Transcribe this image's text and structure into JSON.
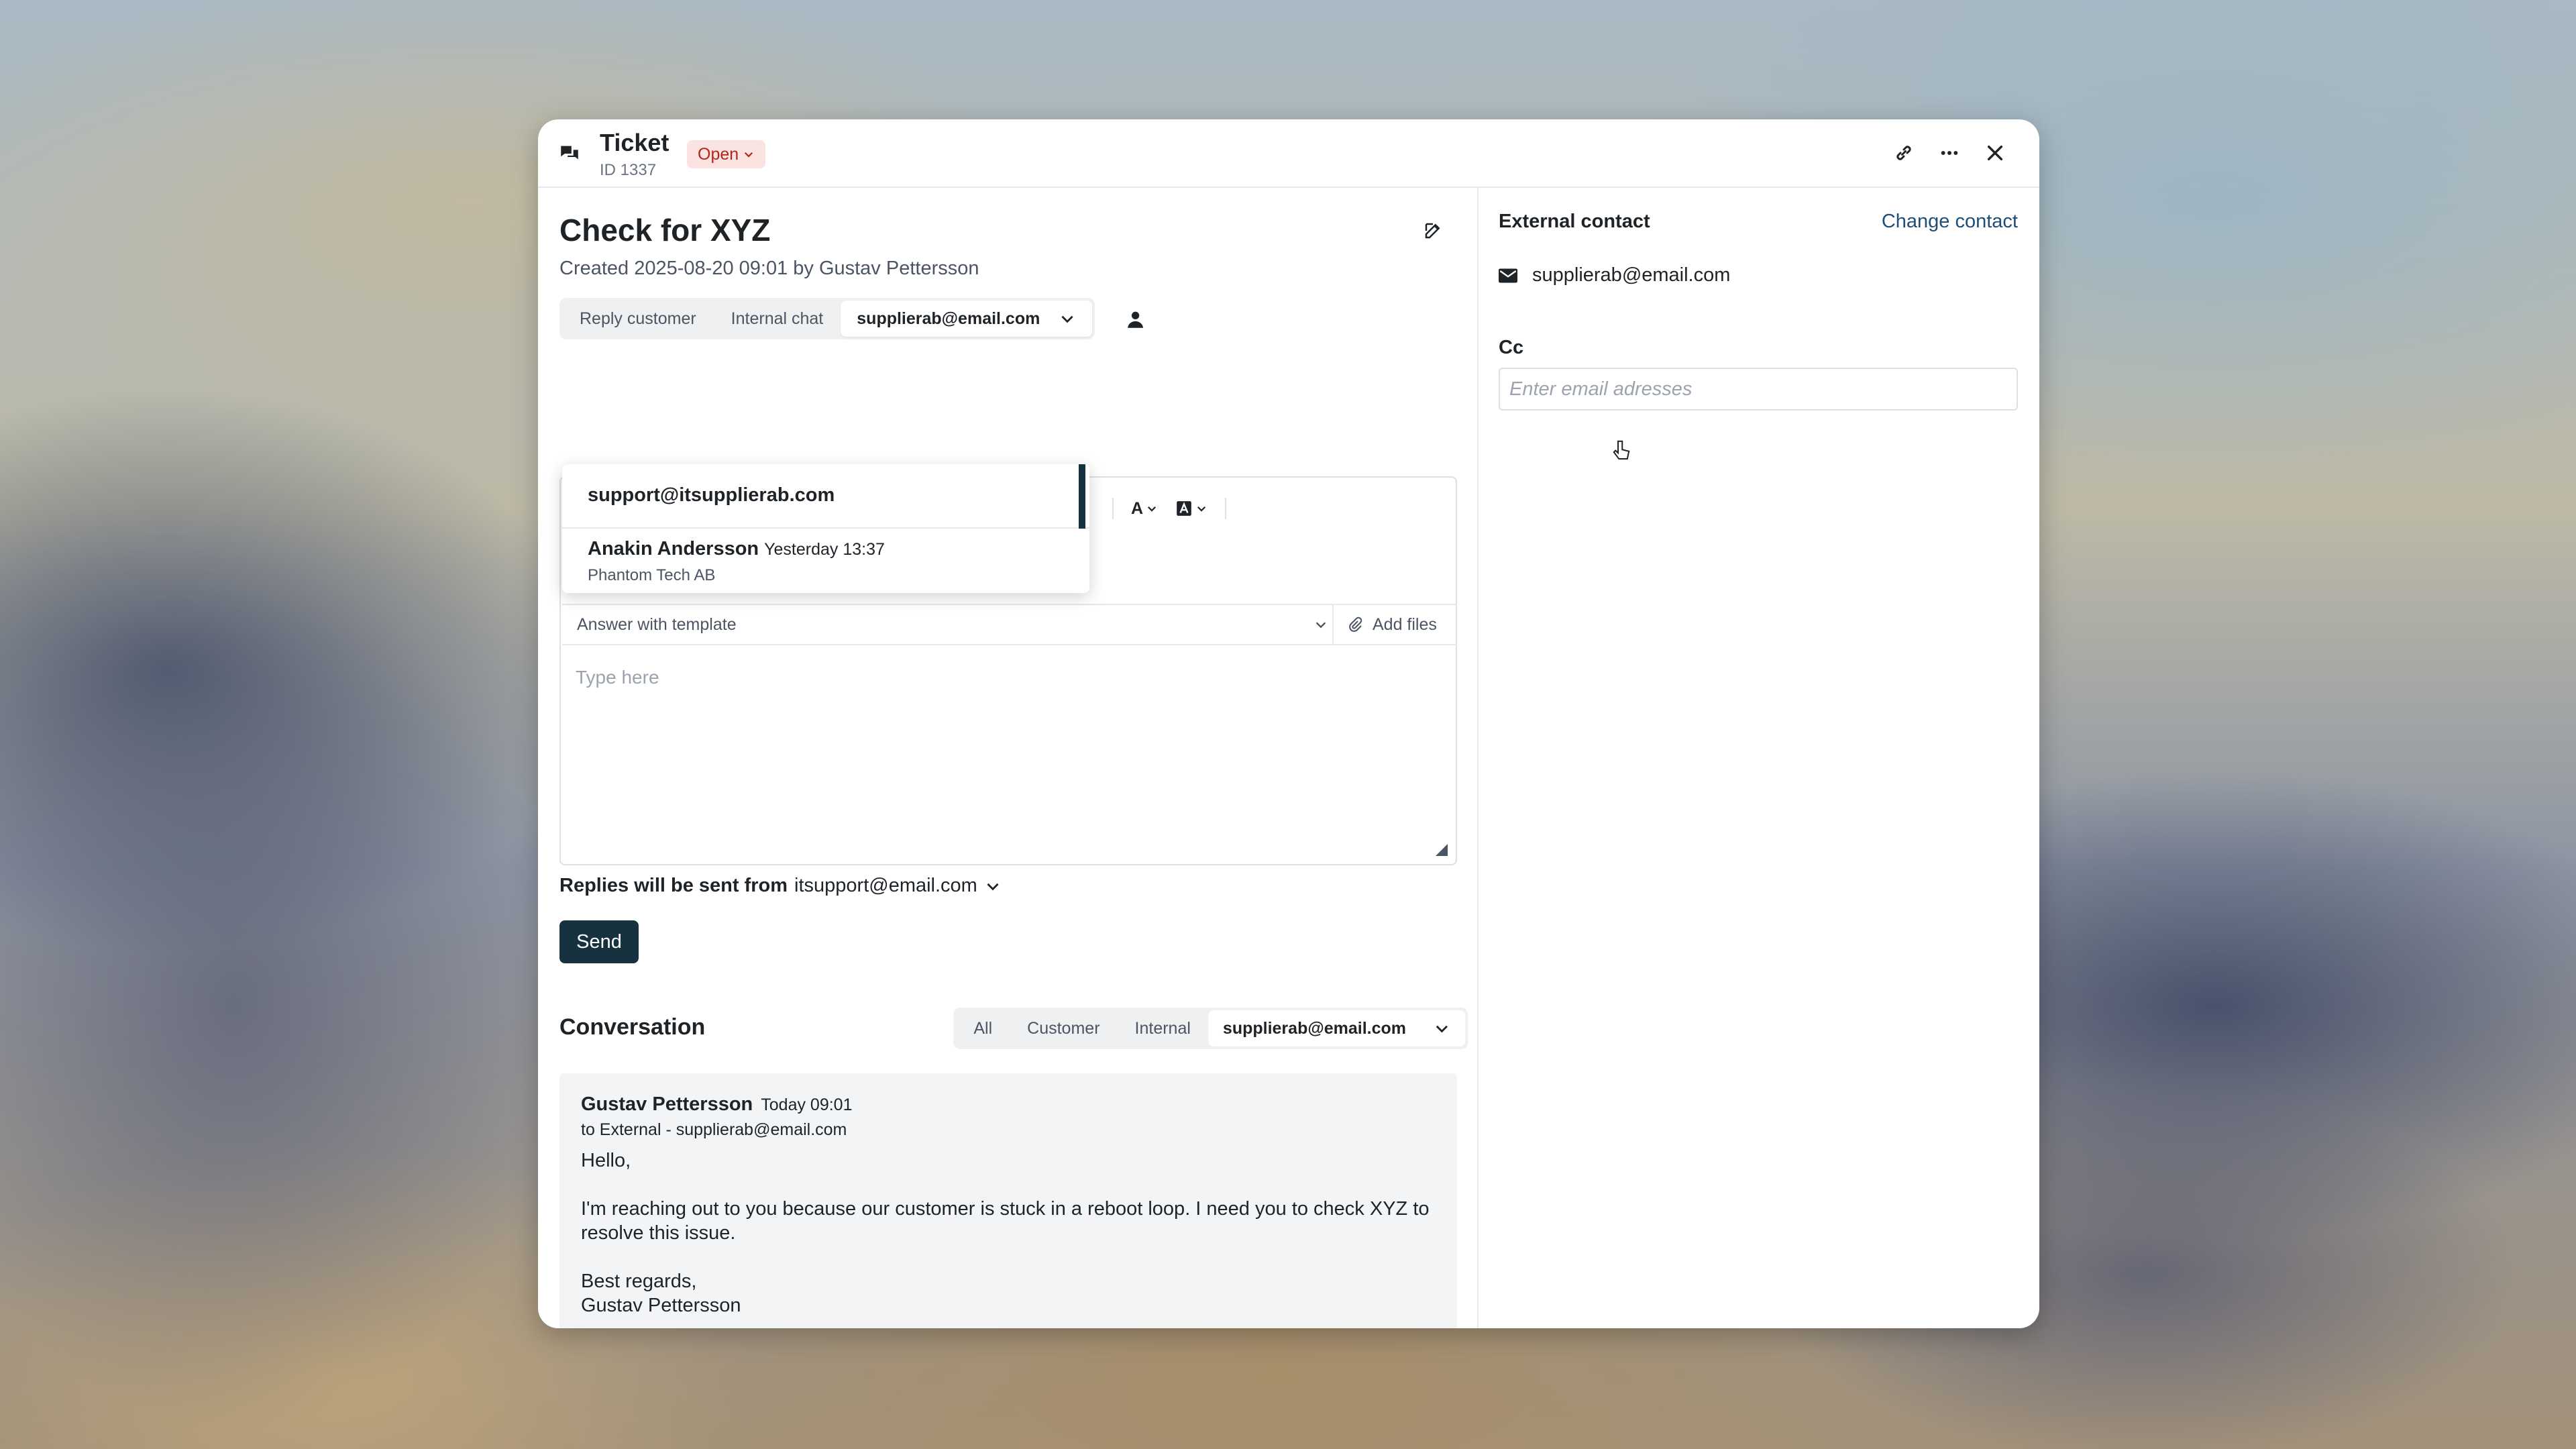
{
  "header": {
    "title": "Ticket",
    "ticket_id": "ID 1337",
    "status": "Open"
  },
  "ticket": {
    "title": "Check for XYZ",
    "created": "Created 2025-08-20 09:01 by Gustav Pettersson"
  },
  "reply_tabs": {
    "reply_customer": "Reply customer",
    "internal_chat": "Internal chat",
    "recipient": "supplierab@email.com"
  },
  "recipient_dropdown": {
    "items": [
      {
        "email": "support@itsupplierab.com"
      },
      {
        "name": "Anakin Andersson",
        "time": "Yesterday 13:37",
        "company": "Phantom Tech AB"
      }
    ]
  },
  "toolbar": {
    "font_color": "A"
  },
  "editor": {
    "template_placeholder": "Answer with template",
    "add_files": "Add files",
    "placeholder": "Type here"
  },
  "reply_from": {
    "label": "Replies will be sent from",
    "value": "itsupport@email.com"
  },
  "send_label": "Send",
  "conversation": {
    "title": "Conversation",
    "filters": [
      "All",
      "Customer",
      "Internal"
    ],
    "selected_filter": "supplierab@email.com",
    "message": {
      "author": "Gustav Pettersson",
      "time": "Today 09:01",
      "to": "to External - supplierab@email.com",
      "greeting": "Hello,",
      "body": "I'm reaching out to you because our customer is stuck in a reboot loop. I need you to check XYZ to resolve this issue.",
      "closing": "Best regards,",
      "signature": "Gustav Pettersson"
    }
  },
  "side": {
    "title": "External contact",
    "change_contact": "Change contact",
    "contact_email": "supplierab@email.com",
    "cc_label": "Cc",
    "cc_placeholder": "Enter email adresses"
  },
  "colors": {
    "primary": "#17323f",
    "link": "#1f4e79",
    "status_bg": "#fbe3e1",
    "status_text": "#b3261e"
  }
}
